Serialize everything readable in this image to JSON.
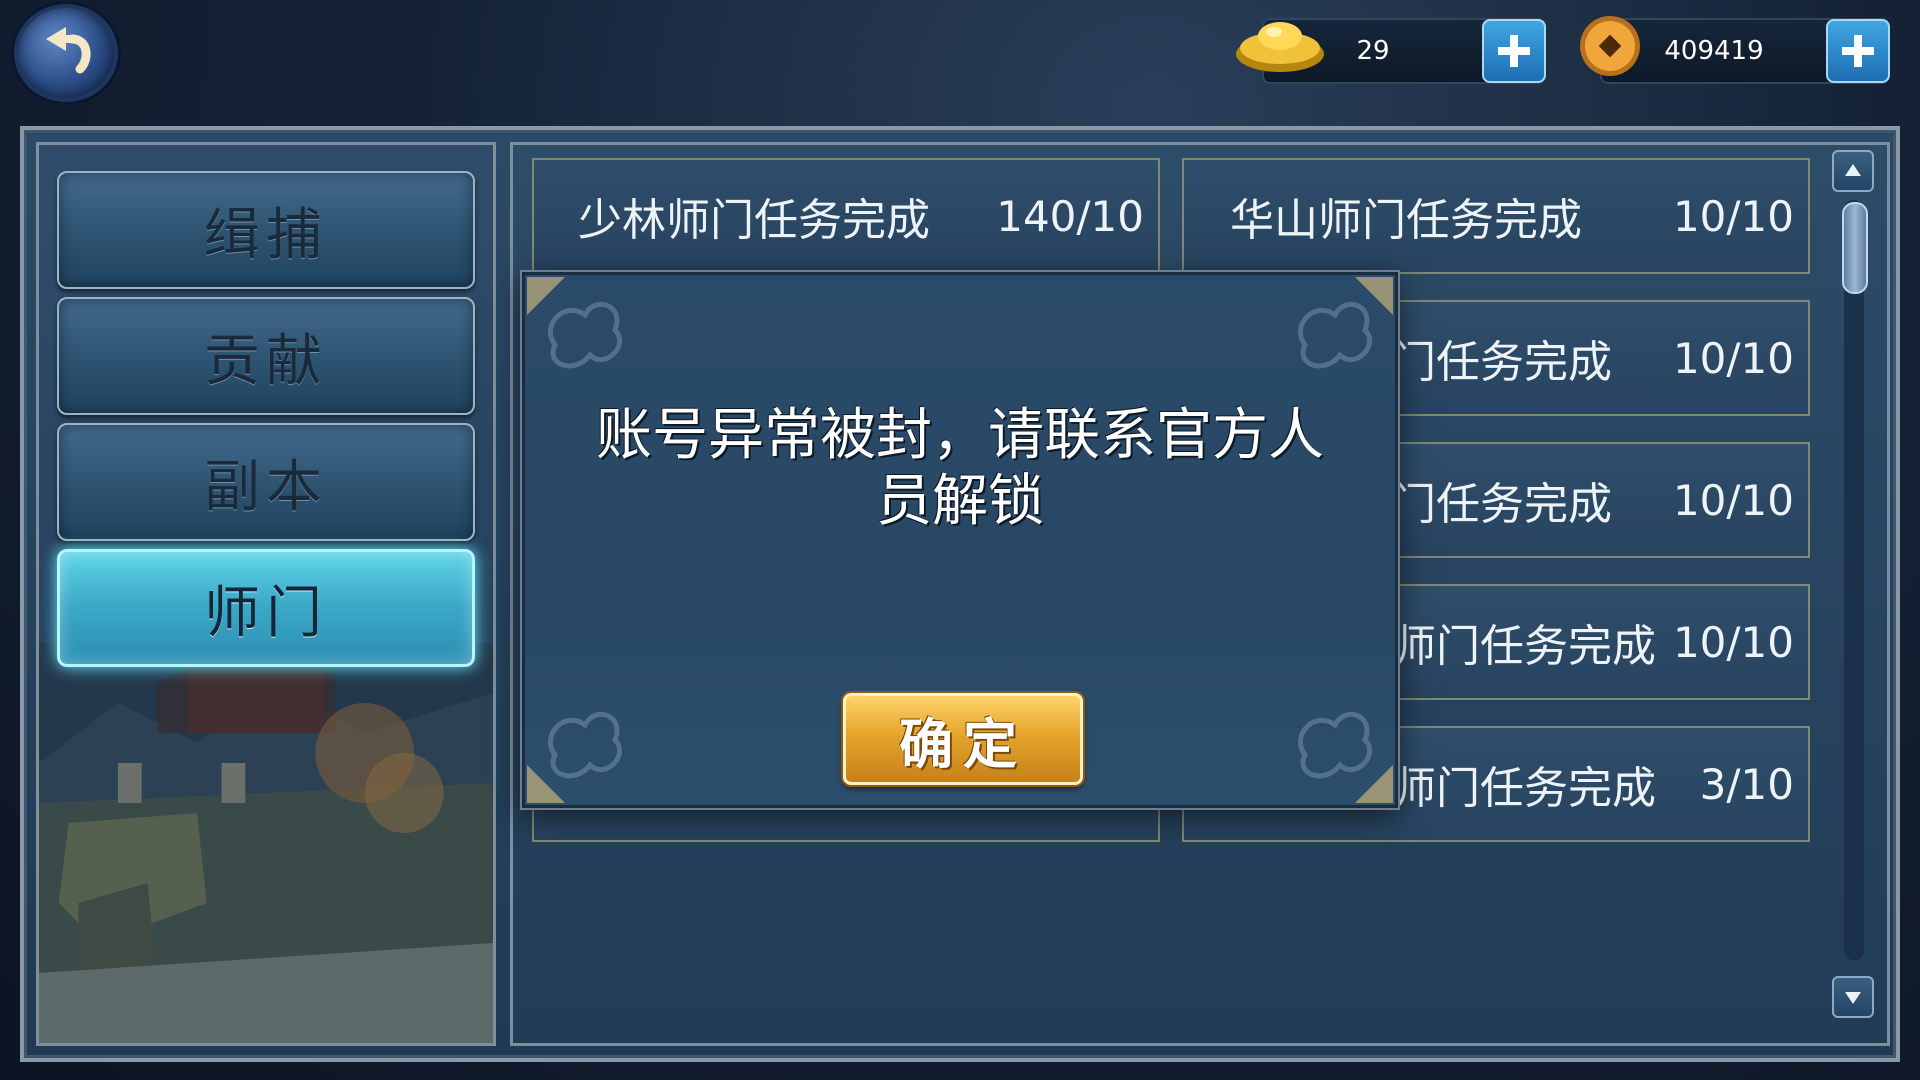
{
  "top_bar": {
    "back_icon": "back-arrow-icon",
    "gold_ingot_icon": "gold-ingot-icon",
    "gold_amount": "29",
    "coin_icon": "copper-coin-icon",
    "coin_amount": "409419",
    "add_icon": "plus-icon"
  },
  "tabs": [
    {
      "label": "缉捕",
      "active": false
    },
    {
      "label": "贡献",
      "active": false
    },
    {
      "label": "副本",
      "active": false
    },
    {
      "label": "师门",
      "active": true
    }
  ],
  "task_cards": [
    {
      "title": "少林师门任务完成",
      "count": "140/10"
    },
    {
      "title": "华山师门任务完成",
      "count": "10/10"
    },
    {
      "title": "门任务完成",
      "count": "10/10"
    },
    {
      "title": "门任务完成",
      "count": "10/10"
    },
    {
      "title": "师门任务完成",
      "count": "10/10"
    },
    {
      "title": "师门任务完成",
      "count": "3/10"
    }
  ],
  "dialog": {
    "message_line1": "账号异常被封，请联系官方人",
    "message_line2": "员解锁",
    "confirm_label": "确定"
  },
  "colors": {
    "active_tab": "#3aa7c6",
    "confirm_button": "#e5a52c",
    "plus_button": "#1d6eb2"
  }
}
